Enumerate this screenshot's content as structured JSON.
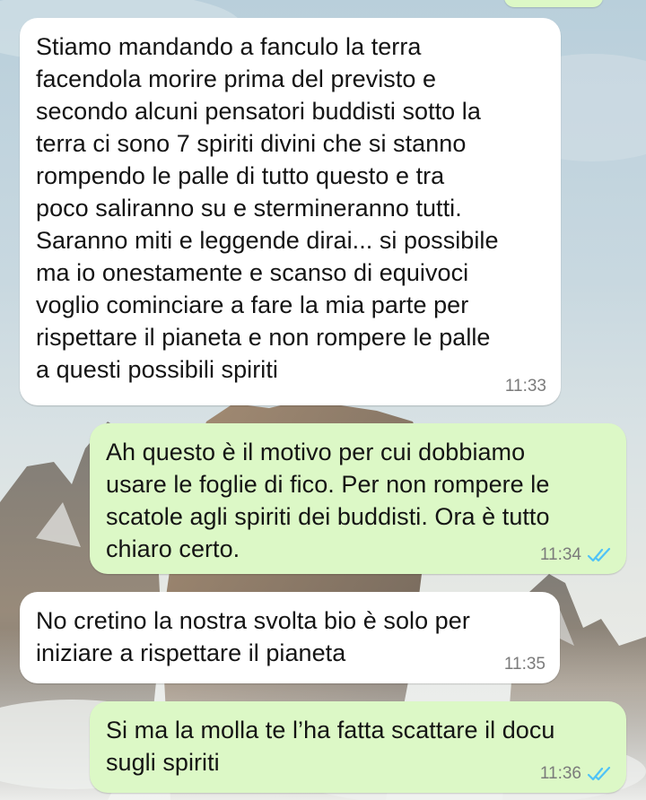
{
  "chat": {
    "messages": [
      {
        "direction": "incoming",
        "text": "Stiamo mandando a fanculo la terra\nfacendola morire prima del previsto e\nsecondo alcuni pensatori buddisti sotto la\nterra ci sono 7 spiriti divini che si stanno\nrompendo le palle di tutto questo e tra\npoco saliranno su e stermineranno tutti.\nSaranno miti e leggende dirai... si possibile\nma io onestamente e scanso di equivoci\nvoglio cominciare a fare la mia parte per\nrispettare il pianeta e non rompere le palle\na questi possibili spiriti",
        "time": "11:33"
      },
      {
        "direction": "outgoing",
        "text": "Ah questo è il motivo per cui dobbiamo\nusare le foglie di fico. Per non rompere le\nscatole agli spiriti dei buddisti. Ora è tutto\nchiaro certo.",
        "time": "11:34",
        "status_icon": "double-check-read-icon"
      },
      {
        "direction": "incoming",
        "text": "No cretino la nostra svolta bio è solo per\niniziare a rispettare il pianeta",
        "time": "11:35"
      },
      {
        "direction": "outgoing",
        "text": "Si ma la molla te l’ha fatta scattare il docu\nsugli spiriti",
        "time": "11:36",
        "status_icon": "double-check-read-icon"
      }
    ]
  },
  "colors": {
    "incoming_bubble": "#ffffff",
    "outgoing_bubble": "#dcf8c6",
    "read_ticks": "#4fc3f7",
    "timestamp": "#7b7b7b"
  },
  "wallpaper": "mountain-peaks-landscape"
}
